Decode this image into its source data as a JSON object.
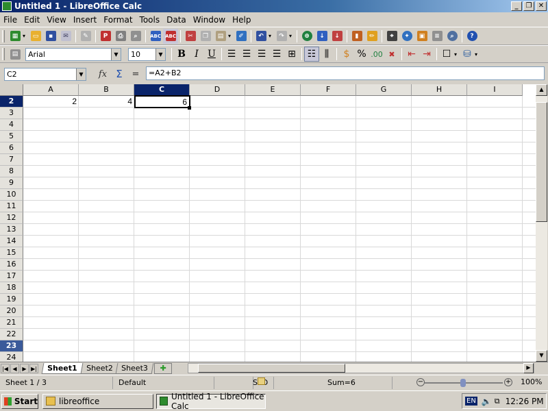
{
  "window": {
    "title": "Untitled 1 - LibreOffice Calc",
    "controls": [
      "_",
      "❐",
      "✕"
    ]
  },
  "menu": [
    "File",
    "Edit",
    "View",
    "Insert",
    "Format",
    "Tools",
    "Data",
    "Window",
    "Help"
  ],
  "format_toolbar": {
    "font_name": "Arial",
    "font_size": "10"
  },
  "formula_bar": {
    "name_box": "C2",
    "formula": "=A2+B2"
  },
  "columns": [
    "A",
    "B",
    "C",
    "D",
    "E",
    "F",
    "G",
    "H",
    "I"
  ],
  "selected_column": "C",
  "rows": [
    "2",
    "3",
    "4",
    "5",
    "6",
    "7",
    "8",
    "9",
    "10",
    "11",
    "12",
    "13",
    "14",
    "15",
    "16",
    "17",
    "18",
    "19",
    "20",
    "21",
    "22",
    "23",
    "24"
  ],
  "selected_row": "2",
  "cells": {
    "A2": "2",
    "B2": "4",
    "C2": "6"
  },
  "sheet_tabs": [
    "Sheet1",
    "Sheet2",
    "Sheet3"
  ],
  "active_sheet": "Sheet1",
  "status": {
    "sheet_pos": "Sheet 1 / 3",
    "page_style": "Default",
    "mode": "STD",
    "sum": "Sum=6",
    "zoom": "100%"
  },
  "taskbar": {
    "start": "Start",
    "buttons": [
      "libreoffice",
      "Untitled 1 - LibreOffice Calc"
    ],
    "lang": "EN",
    "clock": "12:26 PM"
  },
  "colors": {
    "selection": "#0a246a",
    "titlebar": "#0a246a"
  }
}
